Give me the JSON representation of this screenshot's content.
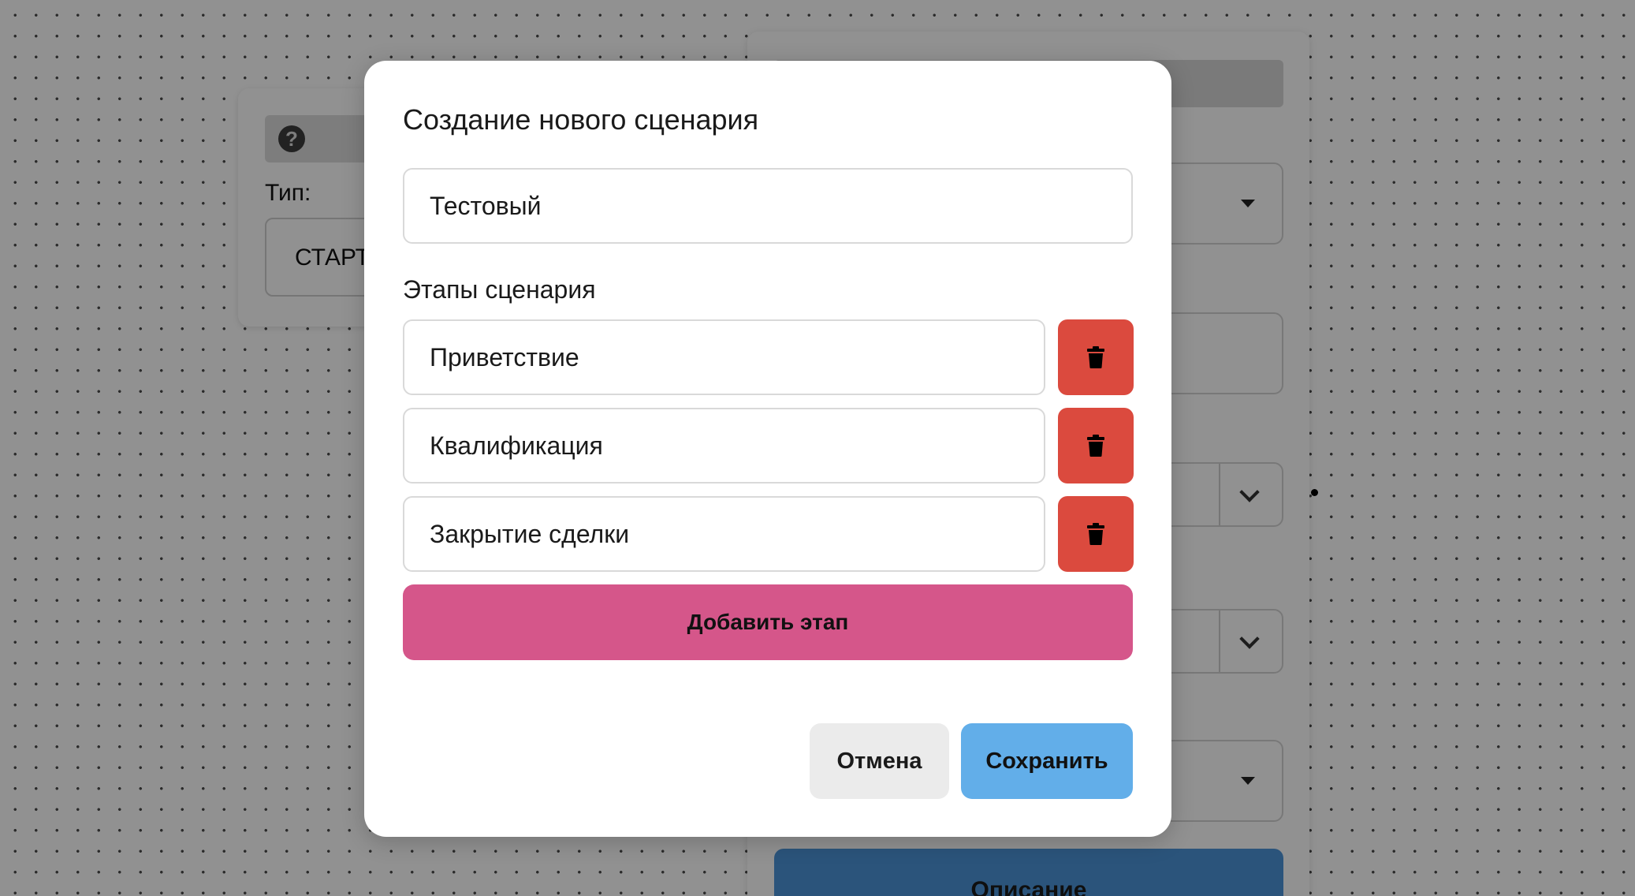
{
  "background": {
    "node_card": {
      "help_icon": "question-circle-icon",
      "type_label": "Тип:",
      "type_value": "СТАРТ"
    },
    "side_panel": {
      "description_button_label": "Описание"
    }
  },
  "modal": {
    "title": "Создание нового сценария",
    "scenario_name_value": "Тестовый",
    "stages_label": "Этапы сценария",
    "stages": [
      {
        "value": "Приветствие",
        "delete_icon": "trash-icon"
      },
      {
        "value": "Квалификация",
        "delete_icon": "trash-icon"
      },
      {
        "value": "Закрытие сделки",
        "delete_icon": "trash-icon"
      }
    ],
    "add_stage_label": "Добавить этап",
    "cancel_label": "Отмена",
    "save_label": "Сохранить"
  },
  "colors": {
    "delete_button": "#db4a3e",
    "add_stage_button": "#d5568a",
    "save_button": "#62aee9",
    "cancel_button": "#ebebeb",
    "description_button": "#4d95d8"
  }
}
